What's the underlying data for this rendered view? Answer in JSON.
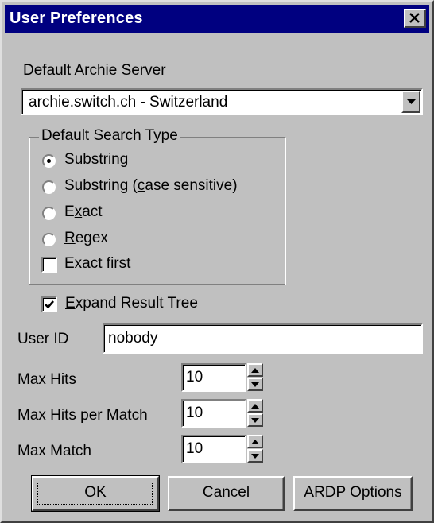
{
  "window": {
    "title": "User Preferences",
    "close_icon": "close-icon"
  },
  "server": {
    "label_pre": "Default ",
    "label_key": "A",
    "label_post": "rchie Server",
    "selected": "archie.switch.ch - Switzerland"
  },
  "search_type": {
    "legend": "Default Search Type",
    "options": [
      {
        "pre": "S",
        "key": "u",
        "post": "bstring",
        "checked": true
      },
      {
        "pre": "Substring (",
        "key": "c",
        "post": "ase sensitive)",
        "checked": false
      },
      {
        "pre": "E",
        "key": "x",
        "post": "act",
        "checked": false
      },
      {
        "pre": "",
        "key": "R",
        "post": "egex",
        "checked": false
      }
    ],
    "exact_first": {
      "pre": "Exac",
      "key": "t",
      "post": " first",
      "checked": false
    }
  },
  "expand": {
    "pre": "",
    "key": "E",
    "post": "xpand Result Tree",
    "checked": true
  },
  "user_id": {
    "label": "User ID",
    "value": "nobody"
  },
  "max_hits": {
    "label": "Max Hits",
    "value": "10"
  },
  "max_hits_per_match": {
    "label": "Max Hits per Match",
    "value": "10"
  },
  "max_match": {
    "label": "Max Match",
    "value": "10"
  },
  "buttons": {
    "ok": "OK",
    "cancel": "Cancel",
    "ardp": "ARDP Options"
  }
}
